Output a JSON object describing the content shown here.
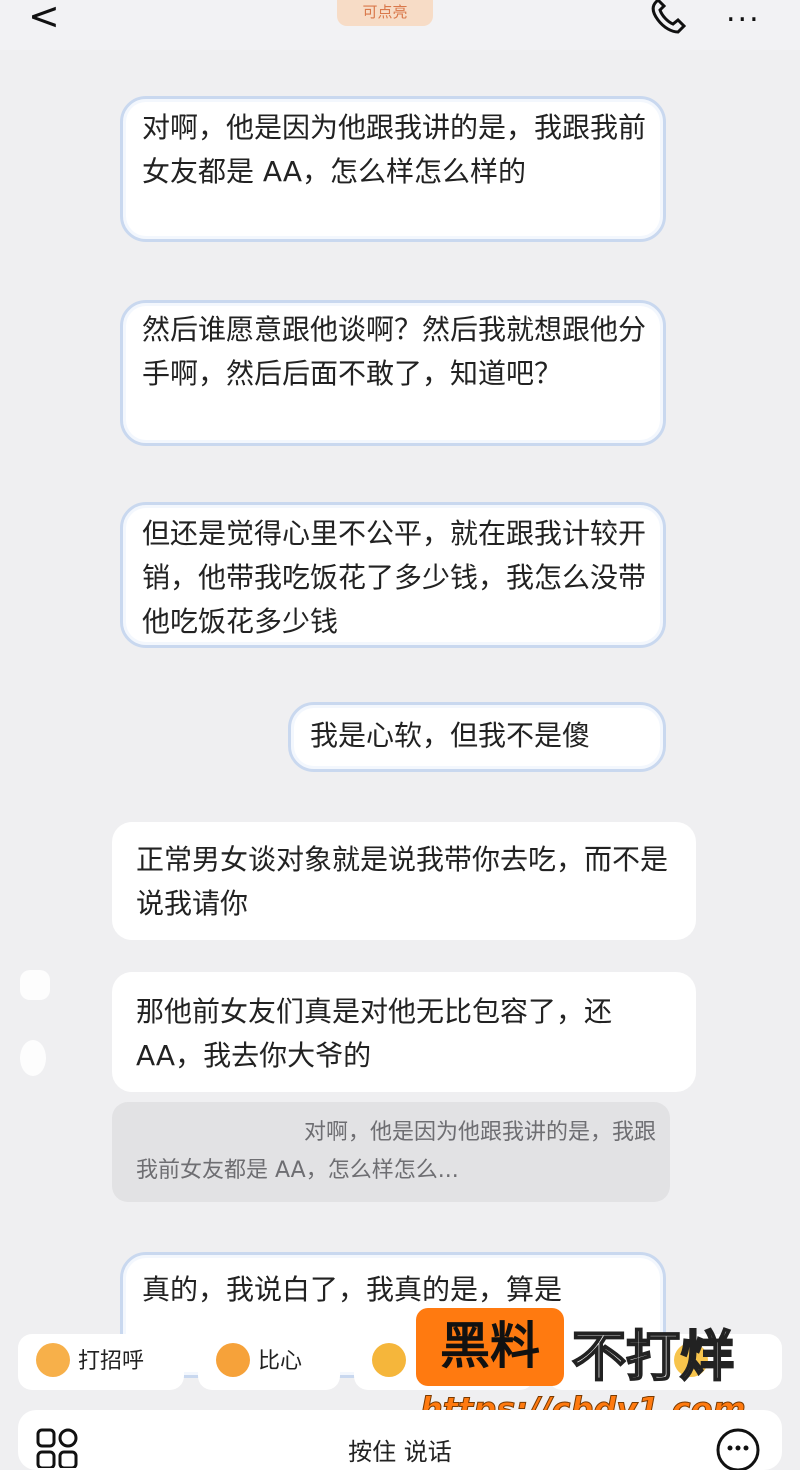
{
  "header": {
    "back_glyph": "<",
    "badge_text": "可点亮",
    "more_glyph": "..."
  },
  "messages": [
    {
      "id": "m1",
      "style": "decorated",
      "text": "对啊，他是因为他跟我讲的是，我跟我前女友都是 AA，怎么样怎么样的"
    },
    {
      "id": "m2",
      "style": "decorated",
      "text": "然后谁愿意跟他谈啊？然后我就想跟他分手啊，然后后面不敢了，知道吧？"
    },
    {
      "id": "m3",
      "style": "decorated",
      "text": "但还是觉得心里不公平，就在跟我计较开销，他带我吃饭花了多少钱，我怎么没带他吃饭花多少钱"
    },
    {
      "id": "m4",
      "style": "decorated",
      "text": "我是心软，但我不是傻"
    },
    {
      "id": "m5",
      "style": "plain",
      "text": "正常男女谈对象就是说我带你去吃，而不是说我请你"
    },
    {
      "id": "m6",
      "style": "plain",
      "text": "那他前女友们真是对他无比包容了，还 AA，我去你大爷的"
    },
    {
      "id": "m8",
      "style": "decorated",
      "text": "真的，我说白了，我真的是，算是"
    }
  ],
  "quote": {
    "text": "对啊，他是因为他跟我讲的是，我跟我前女友都是 AA，怎么样怎么..."
  },
  "quick_replies": [
    {
      "label": "打招呼",
      "icon": "smile-emoji-icon"
    },
    {
      "label": "比心",
      "icon": "heart-hands-emoji-icon"
    },
    {
      "label": "",
      "icon": "thumbs-up-emoji-icon"
    },
    {
      "label": "",
      "icon": "emoji-icon"
    }
  ],
  "input": {
    "hold_to_talk": "按住 说话"
  },
  "watermark": {
    "box_text": "黑料",
    "text": "不打烊",
    "url": "https://cbdy1.com"
  },
  "colors": {
    "background": "#efeff1",
    "bubble_border": "#c9d8ef",
    "badge": "#f7dcc6",
    "watermark": "#ff7a10"
  }
}
